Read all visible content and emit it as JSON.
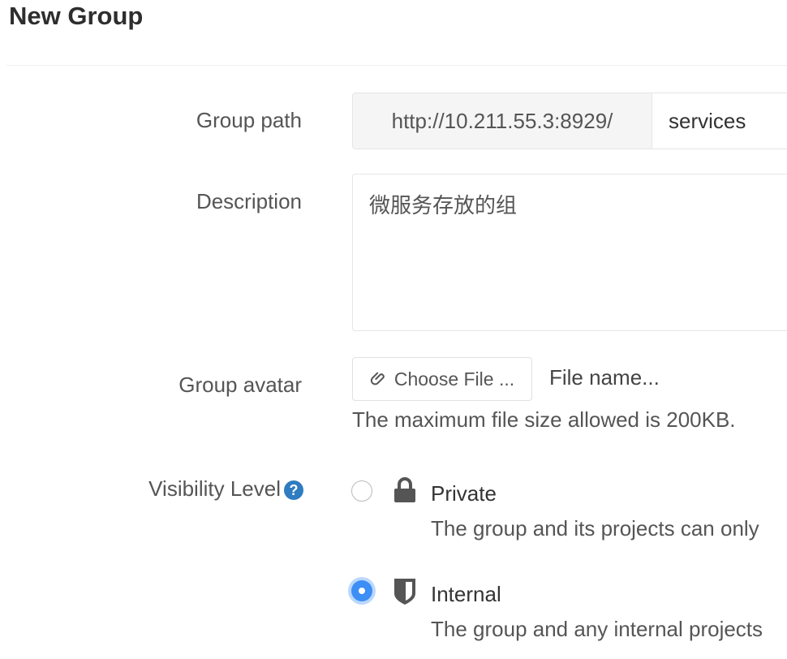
{
  "page": {
    "title": "New Group"
  },
  "form": {
    "group_path": {
      "label": "Group path",
      "prefix": "http://10.211.55.3:8929/",
      "value": "services"
    },
    "description": {
      "label": "Description",
      "value": "微服务存放的组"
    },
    "avatar": {
      "label": "Group avatar",
      "button_label": "Choose File ...",
      "file_name": "File name...",
      "help": "The maximum file size allowed is 200KB."
    },
    "visibility": {
      "label": "Visibility Level",
      "help_icon": "question-circle-icon",
      "options": [
        {
          "label": "Private",
          "icon": "lock-icon",
          "description": "The group and its projects can only",
          "selected": false
        },
        {
          "label": "Internal",
          "icon": "shield-icon",
          "description": "The group and any internal projects",
          "selected": true
        }
      ]
    }
  },
  "colors": {
    "accent": "#3d8ef5",
    "help": "#2f7cc1"
  }
}
